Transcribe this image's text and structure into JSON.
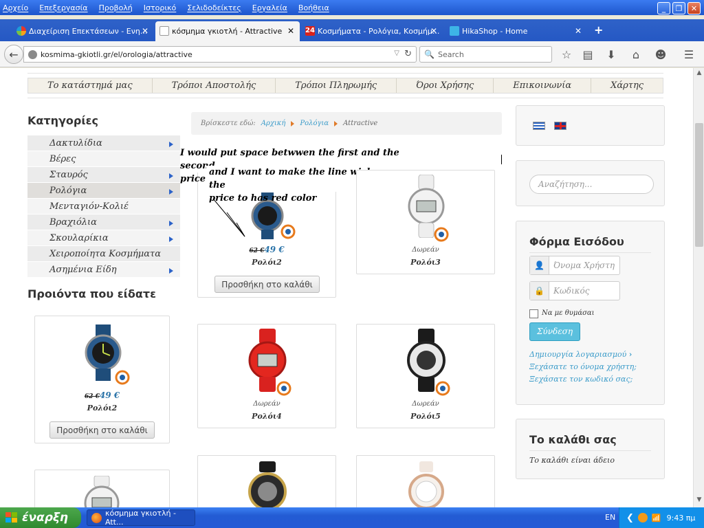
{
  "menu": [
    "Αρχείο",
    "Επεξεργασία",
    "Προβολή",
    "Ιστορικό",
    "Σελιδοδείκτες",
    "Εργαλεία",
    "Βοήθεια"
  ],
  "tabs": [
    {
      "label": "Διαχείριση Επεκτάσεων - Ενη...",
      "icon": "joomla-icon",
      "active": false
    },
    {
      "label": "κόσμημα γκιοτλή - Attractive",
      "icon": "site-favicon",
      "active": true
    },
    {
      "label": "Κοσμήματα - Ρολόγια, Κοσμήμ...",
      "icon": "24-icon",
      "active": false
    },
    {
      "label": "HikaShop - Home",
      "icon": "hikashop-icon",
      "active": false
    }
  ],
  "address": {
    "url": "kosmima-gkiotli.gr/el/orologia/attractive",
    "search_placeholder": "Search"
  },
  "topnav": [
    "Το κατάστημά μας",
    "Τρόποι Αποστολής",
    "Τρόποι Πληρωμής",
    "Όροι Χρήσης",
    "Επικοινωνία",
    "Χάρτης"
  ],
  "categories": {
    "title": "Κατηγορίες",
    "items": [
      {
        "label": "Δακτυλίδια",
        "arrow": true
      },
      {
        "label": "Βέρες",
        "arrow": false
      },
      {
        "label": "Σταυρός",
        "arrow": true
      },
      {
        "label": "Ρολόγια",
        "arrow": true
      },
      {
        "label": "Μενταγιόν-Κολιέ",
        "arrow": false
      },
      {
        "label": "Βραχιόλια",
        "arrow": true
      },
      {
        "label": "Σκουλαρίκια",
        "arrow": true
      },
      {
        "label": "Χειροποίητα Κοσμήματα",
        "arrow": false
      },
      {
        "label": "Ασημένια Είδη",
        "arrow": true
      }
    ]
  },
  "breadcrumb": {
    "prefix": "Βρίσκεστε εδώ:",
    "home": "Αρχική",
    "section": "Ρολόγια",
    "current": "Attractive"
  },
  "annotation": {
    "line1": "I would put space betwwen the first and the second",
    "line2": "price",
    "line3": "and I want to make the line wich remove the",
    "line4": "price to has red color"
  },
  "products": {
    "p2": {
      "old_price": "62 €",
      "new_price": "49 €",
      "name": "Ρολόι2",
      "button": "Προσθήκη στο καλάθι"
    },
    "p3": {
      "free": "Δωρεάν",
      "name": "Ρολόι3"
    },
    "p4": {
      "free": "Δωρεάν",
      "name": "Ρολόι4"
    },
    "p5": {
      "free": "Δωρεάν",
      "name": "Ρολόι5"
    }
  },
  "viewed": {
    "title": "Προιόντα που είδατε",
    "item": {
      "old_price": "62 €",
      "new_price": "49 €",
      "name": "Ρολόι2",
      "button": "Προσθήκη στο καλάθι"
    }
  },
  "right": {
    "search_placeholder": "Αναζήτηση...",
    "login_title": "Φόρμα Εισόδου",
    "username_placeholder": "Όνομα Χρήστη",
    "password_placeholder": "Κωδικός",
    "remember": "Να με θυμάσαι",
    "login_button": "Σύνδεση",
    "create_account": "Δημιουργία λογαριασμού",
    "forgot_username": "Ξεχάσατε το όνομα χρήστη;",
    "forgot_password": "Ξεχάσατε τον κωδικό σας;",
    "cart_title": "Το καλάθι σας",
    "cart_empty": "Το καλάθι είναι άδειο"
  },
  "taskbar": {
    "start": "έναρξη",
    "window": "κόσμημα γκιοτλή - Att...",
    "lang": "EN",
    "clock": "9:43 πμ"
  }
}
